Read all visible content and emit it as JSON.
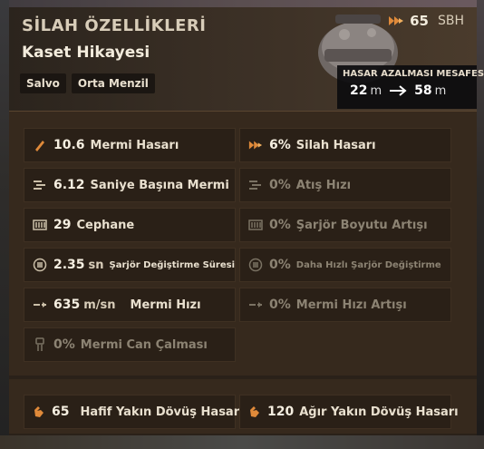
{
  "header": {
    "title": "SİLAH ÖZELLİKLERİ",
    "subtitle": "Kaset Hikayesi",
    "tags": [
      "Salvo",
      "Orta Menzil"
    ],
    "level_value": "65",
    "level_unit": "SBH",
    "falloff_label": "HASAR AZALMASI MESAFESİ",
    "falloff_from": "22",
    "falloff_from_unit": "m",
    "falloff_to": "58",
    "falloff_to_unit": "m"
  },
  "stats": {
    "bullet_damage": {
      "value": "10.6",
      "label": "Mermi Hasarı"
    },
    "weapon_damage": {
      "value": "6%",
      "label": "Silah Hasarı"
    },
    "bullets_per_sec": {
      "value": "6.12",
      "label": "Saniye Başına Mermi"
    },
    "fire_rate": {
      "value": "0%",
      "label": "Atış Hızı"
    },
    "ammo": {
      "value": "29",
      "label": "Cephane"
    },
    "clip_size": {
      "value": "0%",
      "label": "Şarjör Boyutu Artışı"
    },
    "reload_time": {
      "value": "2.35",
      "unit": "sn",
      "label": "Şarjör Değiştirme Süresi"
    },
    "reload_faster": {
      "value": "0%",
      "label": "Daha Hızlı Şarjör Değiştirme"
    },
    "bullet_speed": {
      "value": "635",
      "unit": "m/sn",
      "label": "Mermi Hızı"
    },
    "bullet_speed_inc": {
      "value": "0%",
      "label": "Mermi Hızı Artışı"
    },
    "lifesteal": {
      "value": "0%",
      "label": "Mermi Can Çalması"
    }
  },
  "melee": {
    "light": {
      "value": "65",
      "label": "Hafif Yakın Dövüş Hasarı"
    },
    "heavy": {
      "value": "120",
      "label": "Ağır Yakın Dövüş Hasarı"
    }
  },
  "colors": {
    "accent": "#e08a3a",
    "panel": "#36291d",
    "cell": "#2a2017"
  }
}
